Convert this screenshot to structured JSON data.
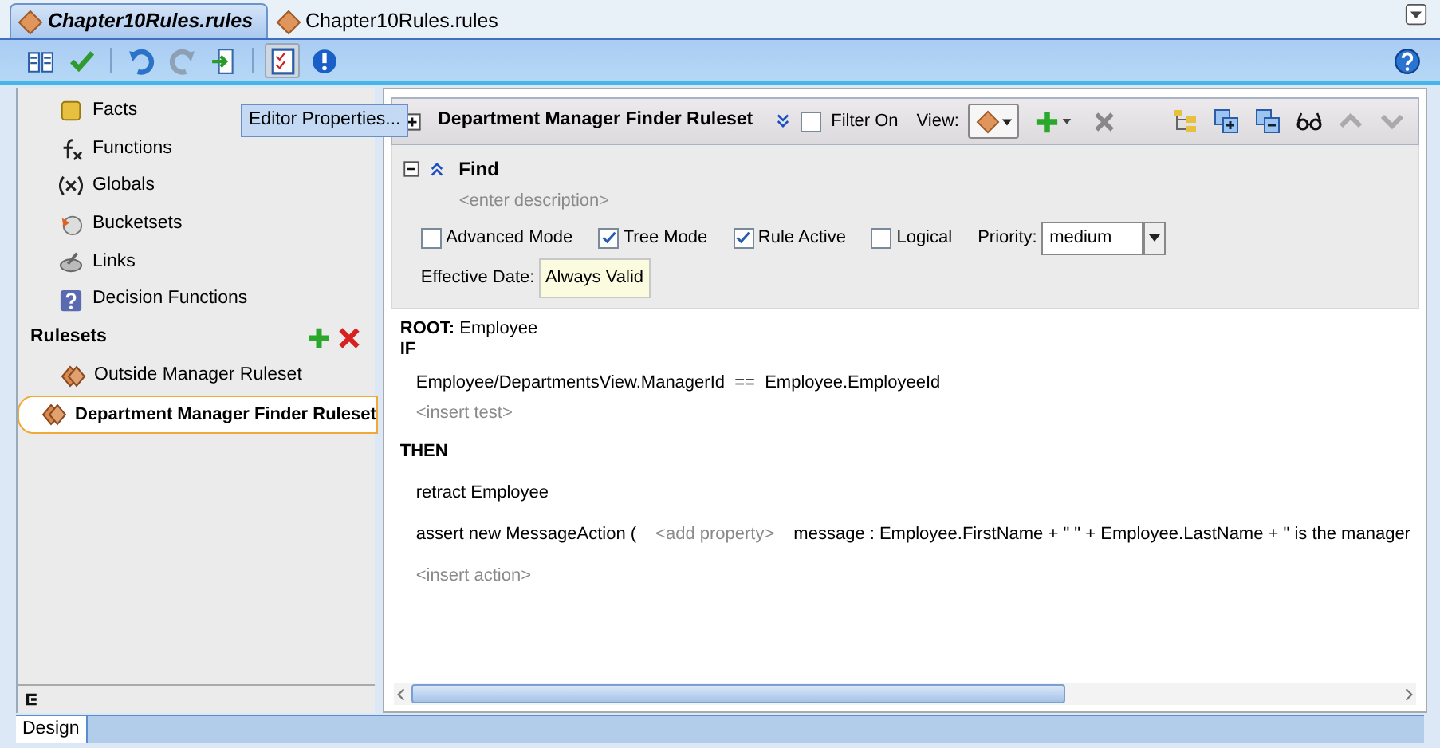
{
  "file_tabs": [
    {
      "label": "Chapter10Rules.rules",
      "selected": true
    },
    {
      "label": "Chapter10Rules.rules",
      "selected": false
    }
  ],
  "toolbar": {
    "buttons": [
      {
        "kind": "book",
        "pressed": false,
        "disabled": false
      },
      {
        "kind": "check",
        "pressed": false,
        "disabled": false
      },
      {
        "kind": "sep"
      },
      {
        "kind": "undo",
        "pressed": false,
        "disabled": false
      },
      {
        "kind": "redo",
        "pressed": false,
        "disabled": true
      },
      {
        "kind": "import",
        "pressed": false,
        "disabled": false
      },
      {
        "kind": "sep"
      },
      {
        "kind": "properties",
        "pressed": true,
        "disabled": false
      },
      {
        "kind": "alert",
        "pressed": false,
        "disabled": false
      }
    ]
  },
  "tooltip": "Editor Properties...",
  "sidebar": {
    "items": [
      {
        "kind": "facts",
        "label": "Facts"
      },
      {
        "kind": "functions",
        "label": "Functions"
      },
      {
        "kind": "globals",
        "label": "Globals"
      },
      {
        "kind": "bucketsets",
        "label": "Bucketsets"
      },
      {
        "kind": "links",
        "label": "Links"
      },
      {
        "kind": "decision",
        "label": "Decision Functions"
      }
    ],
    "rulesets_title": "Rulesets",
    "rulesets": [
      {
        "label": "Outside Manager Ruleset",
        "selected": false
      },
      {
        "label": "Department Manager Finder Ruleset",
        "selected": true
      }
    ]
  },
  "ruleset": {
    "title": "Department Manager Finder Ruleset",
    "filter": {
      "label": "Filter On",
      "checked": false
    },
    "view_label": "View:"
  },
  "rule": {
    "name": "Find",
    "description_placeholder": "<enter description>",
    "options": [
      {
        "label": "Advanced Mode",
        "checked": false
      },
      {
        "label": "Tree Mode",
        "checked": true
      },
      {
        "label": "Rule Active",
        "checked": true
      },
      {
        "label": "Logical",
        "checked": false
      }
    ],
    "priority_label": "Priority:",
    "priority": "medium",
    "effective_date_label": "Effective Date:",
    "effective_date": "Always Valid",
    "root_label": "ROOT:",
    "root": "Employee",
    "if_label": "IF",
    "tests": [
      "Employee/DepartmentsView.ManagerId  ==  Employee.EmployeeId"
    ],
    "insert_test": "<insert test>",
    "then_label": "THEN",
    "actions": [
      {
        "kind": "plain",
        "text": "retract Employee"
      },
      {
        "kind": "assert",
        "text": "assert new MessageAction (",
        "placeholder": "<add property>",
        "detail": "message : Employee.FirstName + \" \" + Employee.LastName + \" is the manager"
      }
    ],
    "insert_action": "<insert action>"
  },
  "bottom_tabs": [
    {
      "label": "Design",
      "selected": true
    }
  ]
}
